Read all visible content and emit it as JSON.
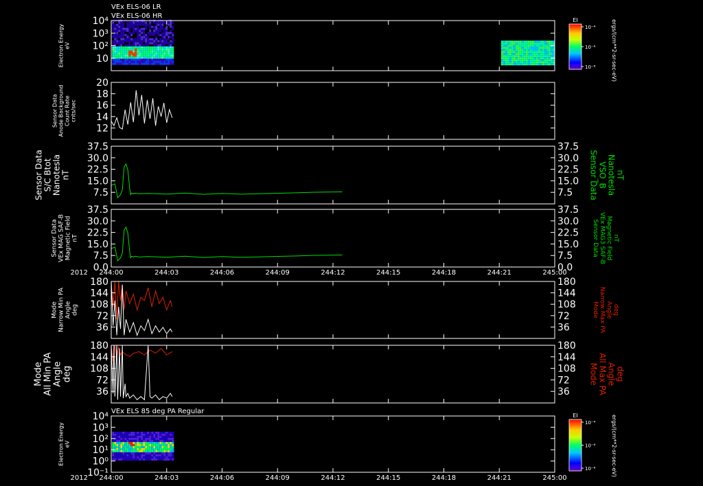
{
  "chart_data": [
    {
      "id": "els_lr_hr",
      "type": "heatmap",
      "titles": [
        "VEx ELS-06 LR",
        "VEx ELS-06 HR"
      ],
      "ylabel": [
        "Electron Energy",
        "eV"
      ],
      "yscale": "log",
      "ylim": [
        1,
        10000
      ],
      "yticks": [
        {
          "v": 10,
          "t": "10"
        },
        {
          "v": 100,
          "t": "10²"
        },
        {
          "v": 1000,
          "t": "10³"
        },
        {
          "v": 10000,
          "t": "10⁴"
        }
      ],
      "colorbar": {
        "title": "EI",
        "unit": "ergs/(cm**2-sr-sec-eV)",
        "ticks": [
          "10⁻⁴",
          "10⁻⁶",
          "10⁻⁸"
        ]
      },
      "blocks": [
        {
          "t0": 0.05,
          "t1": 3.3,
          "e0": 3,
          "e1": 12000,
          "kind": "solarwind"
        },
        {
          "t0": 21.1,
          "t1": 23.9,
          "e0": 3,
          "e1": 250,
          "kind": "sheath"
        }
      ],
      "show_time_labels": false
    },
    {
      "id": "background",
      "type": "line",
      "ylabel": [
        "Sensor Data",
        "Anode Background",
        "Count Rate",
        "cnts/sec"
      ],
      "ylim": [
        10,
        20
      ],
      "yticks": [
        {
          "v": 12,
          "t": "12"
        },
        {
          "v": 14,
          "t": "14"
        },
        {
          "v": 16,
          "t": "16"
        },
        {
          "v": 18,
          "t": "18"
        },
        {
          "v": 20,
          "t": "20"
        }
      ],
      "series": [
        {
          "color": "#ffffff",
          "x": [
            0.0,
            0.15,
            0.3,
            0.45,
            0.6,
            0.75,
            0.9,
            1.05,
            1.2,
            1.35,
            1.5,
            1.65,
            1.8,
            1.95,
            2.1,
            2.25,
            2.4,
            2.55,
            2.7,
            2.85,
            3.0,
            3.15,
            3.3
          ],
          "y": [
            13.2,
            12.4,
            13.8,
            12.1,
            11.8,
            15.2,
            12.6,
            16.5,
            13.0,
            18.6,
            14.2,
            17.8,
            12.8,
            16.9,
            13.6,
            17.2,
            12.4,
            15.8,
            14.0,
            16.4,
            12.9,
            15.2,
            13.8
          ]
        }
      ],
      "show_time_labels": false
    },
    {
      "id": "bmag_sc",
      "type": "line",
      "ylabel": [
        "Sensor Data",
        "S/C Btot",
        "Nanotesla",
        "nT"
      ],
      "rlabel": [
        "Sensor Data",
        "VSO_B",
        "Nanotesla",
        "nT"
      ],
      "rcolor": "#00e000",
      "ylim": [
        0,
        37.5
      ],
      "yticks": [
        {
          "v": 7.5,
          "t": "7.5"
        },
        {
          "v": 15,
          "t": "15.0"
        },
        {
          "v": 22.5,
          "t": "22.5"
        },
        {
          "v": 30,
          "t": "30.0"
        },
        {
          "v": 37.5,
          "t": "37.5"
        }
      ],
      "series": [
        {
          "color": "#00e000",
          "x": [
            0.0,
            0.2,
            0.35,
            0.5,
            0.6,
            0.7,
            0.8,
            0.9,
            1.0,
            1.05,
            1.1,
            1.2,
            1.3,
            1.5,
            2.0,
            3.0,
            4.0,
            5.0,
            6.0,
            7.0,
            8.0,
            9.0,
            10.0,
            11.0,
            12.5
          ],
          "y": [
            12,
            13,
            4,
            6,
            9,
            24,
            26,
            22,
            10,
            6,
            7,
            6.5,
            7,
            6.5,
            6.8,
            6.4,
            7.0,
            6.2,
            6.8,
            6.3,
            6.6,
            6.9,
            7.2,
            7.6,
            7.8
          ]
        }
      ],
      "show_time_labels": false
    },
    {
      "id": "bmag_saf",
      "type": "line",
      "ylabel": [
        "Sensor Data",
        "VEx MAG SAF-B",
        "Magnetic Field",
        "nT"
      ],
      "rlabel": [
        "Sensor Data",
        "VEx MAG3 SAF-B",
        "Magnetic Field",
        "nT"
      ],
      "rcolor": "#00e000",
      "ylim": [
        0,
        37.5
      ],
      "yticks": [
        {
          "v": 0,
          "t": "0.0"
        },
        {
          "v": 7.5,
          "t": "7.5"
        },
        {
          "v": 15,
          "t": "15.0"
        },
        {
          "v": 22.5,
          "t": "22.5"
        },
        {
          "v": 30,
          "t": "30.0"
        },
        {
          "v": 37.5,
          "t": "37.5"
        }
      ],
      "series": [
        {
          "color": "#00e000",
          "x": [
            0.0,
            0.2,
            0.35,
            0.5,
            0.6,
            0.7,
            0.8,
            0.9,
            1.0,
            1.05,
            1.1,
            1.2,
            1.3,
            1.5,
            2.0,
            3.0,
            4.0,
            5.0,
            6.0,
            7.0,
            8.0,
            9.0,
            10.0,
            11.0,
            12.5
          ],
          "y": [
            12,
            13,
            4,
            6,
            9,
            24,
            26,
            22,
            10,
            6,
            7,
            6.5,
            7,
            6.5,
            6.8,
            6.4,
            7.0,
            6.2,
            6.8,
            6.3,
            6.6,
            6.9,
            7.2,
            7.6,
            7.8
          ]
        }
      ],
      "show_time_labels": true
    },
    {
      "id": "pa_narrow",
      "type": "line",
      "ylabel": [
        "Mode",
        "Narrow Min PA",
        "Angle",
        "deg"
      ],
      "rlabel": [
        "Mode",
        "Narrow Max PA",
        "Angle",
        "deg"
      ],
      "rcolor": "#e02000",
      "ylim": [
        0,
        180
      ],
      "yticks": [
        {
          "v": 36,
          "t": "36"
        },
        {
          "v": 72,
          "t": "72"
        },
        {
          "v": 108,
          "t": "108"
        },
        {
          "v": 144,
          "t": "144"
        },
        {
          "v": 180,
          "t": "180"
        }
      ],
      "series": [
        {
          "color": "#e02000",
          "x": [
            0.0,
            0.1,
            0.2,
            0.3,
            0.4,
            0.5,
            0.6,
            0.7,
            0.8,
            1.0,
            1.2,
            1.4,
            1.6,
            1.8,
            2.0,
            2.2,
            2.4,
            2.6,
            2.8,
            3.0,
            3.2,
            3.3
          ],
          "y": [
            180,
            100,
            180,
            60,
            180,
            120,
            170,
            90,
            150,
            110,
            140,
            90,
            130,
            120,
            160,
            100,
            150,
            110,
            130,
            90,
            120,
            100
          ]
        },
        {
          "color": "#ffffff",
          "x": [
            0.0,
            0.1,
            0.2,
            0.3,
            0.4,
            0.5,
            0.6,
            0.7,
            0.8,
            1.0,
            1.2,
            1.4,
            1.6,
            1.8,
            2.0,
            2.2,
            2.4,
            2.6,
            2.8,
            3.0,
            3.2,
            3.3
          ],
          "y": [
            180,
            40,
            120,
            10,
            100,
            30,
            170,
            10,
            60,
            20,
            50,
            10,
            40,
            25,
            60,
            15,
            40,
            20,
            35,
            15,
            30,
            20
          ]
        }
      ],
      "show_time_labels": false
    },
    {
      "id": "pa_all",
      "type": "line",
      "ylabel": [
        "Mode",
        "All Min PA",
        "Angle",
        "deg"
      ],
      "rlabel": [
        "Mode",
        "All Max PA",
        "Angle",
        "deg"
      ],
      "rcolor": "#e02000",
      "ylim": [
        0,
        180
      ],
      "yticks": [
        {
          "v": 36,
          "t": "36"
        },
        {
          "v": 72,
          "t": "72"
        },
        {
          "v": 108,
          "t": "108"
        },
        {
          "v": 144,
          "t": "144"
        },
        {
          "v": 180,
          "t": "180"
        }
      ],
      "series": [
        {
          "color": "#e02000",
          "x": [
            0.0,
            0.1,
            0.2,
            0.3,
            0.4,
            0.5,
            0.6,
            0.8,
            1.0,
            1.2,
            1.5,
            1.8,
            2.1,
            2.4,
            2.7,
            3.0,
            3.3
          ],
          "y": [
            180,
            130,
            180,
            140,
            175,
            150,
            160,
            150,
            145,
            155,
            160,
            150,
            165,
            155,
            170,
            150,
            160
          ]
        },
        {
          "color": "#ffffff",
          "x": [
            0.0,
            0.1,
            0.15,
            0.2,
            0.3,
            0.35,
            0.45,
            0.5,
            0.6,
            0.65,
            0.75,
            0.8,
            0.9,
            1.0,
            1.2,
            1.4,
            1.6,
            1.8,
            2.0,
            2.1,
            2.2,
            2.4,
            2.6,
            2.8,
            3.0,
            3.2,
            3.3
          ],
          "y": [
            180,
            30,
            180,
            20,
            180,
            10,
            170,
            20,
            180,
            15,
            60,
            20,
            30,
            15,
            25,
            10,
            20,
            10,
            180,
            20,
            15,
            25,
            10,
            20,
            15,
            30,
            20
          ]
        }
      ],
      "show_time_labels": false
    },
    {
      "id": "els_85deg",
      "type": "heatmap",
      "titles": [
        "VEx ELS 85 deg PA Regular"
      ],
      "ylabel": [
        "Electron Energy",
        "eV"
      ],
      "yscale": "log",
      "ylim": [
        0.1,
        10000
      ],
      "yticks": [
        {
          "v": 0.1,
          "t": "10⁻¹"
        },
        {
          "v": 1,
          "t": "10⁰"
        },
        {
          "v": 10,
          "t": "10¹"
        },
        {
          "v": 100,
          "t": "10²"
        },
        {
          "v": 1000,
          "t": "10³"
        },
        {
          "v": 10000,
          "t": "10⁴"
        }
      ],
      "colorbar": {
        "title": "EI",
        "unit": "ergs/(cm**2-sr-sec-eV)",
        "ticks": [
          "10⁻⁴",
          "10⁻⁶",
          "10⁻⁸"
        ]
      },
      "blocks": [
        {
          "t0": 0.05,
          "t1": 3.3,
          "e0": 1.5,
          "e1": 400,
          "kind": "pa"
        }
      ],
      "show_time_labels": true
    }
  ],
  "time_axis": {
    "xlim": [
      0,
      24
    ],
    "ticks": [
      {
        "v": 0,
        "t": "244:00"
      },
      {
        "v": 3,
        "t": "244:03"
      },
      {
        "v": 6,
        "t": "244:06"
      },
      {
        "v": 9,
        "t": "244:09"
      },
      {
        "v": 12,
        "t": "244:12"
      },
      {
        "v": 15,
        "t": "244:15"
      },
      {
        "v": 18,
        "t": "244:18"
      },
      {
        "v": 21,
        "t": "244:21"
      },
      {
        "v": 24,
        "t": "245:00"
      }
    ],
    "year_label": "2012"
  }
}
